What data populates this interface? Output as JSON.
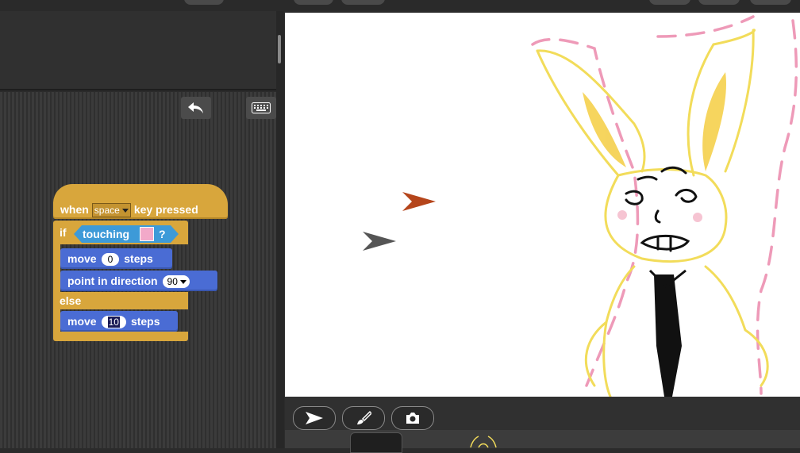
{
  "script": {
    "hat": {
      "when": "when",
      "key": "space",
      "pressed": "key pressed"
    },
    "if_label": "if",
    "touching_label": "touching",
    "question": "?",
    "touching_color": "#f2a9c9",
    "move1": {
      "label": "move",
      "value": "0",
      "unit": "steps"
    },
    "point": {
      "label": "point in direction",
      "value": "90"
    },
    "else_label": "else",
    "move2": {
      "label": "move",
      "value": "10",
      "unit": "steps"
    }
  },
  "toolbar": {
    "undo_icon": "undo-icon",
    "keyboard_icon": "keyboard-icon"
  },
  "stage_controls": {
    "arrow_icon": "arrow-icon",
    "brush_icon": "paintbrush-icon",
    "camera_icon": "camera-icon"
  },
  "colors": {
    "hat": "#d8a63c",
    "motion": "#4a6cd4",
    "sensing": "#3d9ad8",
    "sprite1": "#b5451b",
    "sprite2": "#555555"
  }
}
